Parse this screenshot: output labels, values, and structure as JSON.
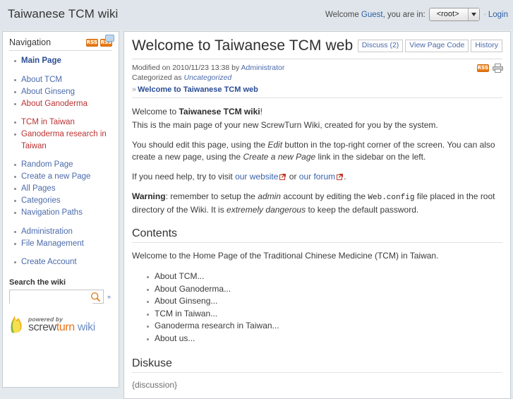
{
  "header": {
    "wiki_title": "Taiwanese TCM wiki",
    "welcome_prefix": "Welcome",
    "user_name": "Guest",
    "welcome_suffix": ", you are in:",
    "namespace_value": "<root>",
    "separator": "·",
    "login_label": "Login"
  },
  "sidebar": {
    "heading": "Navigation",
    "rss_label": "RSS",
    "rss_discussion_label": "RSS",
    "items": [
      {
        "label": "Main Page",
        "style": "bold"
      },
      {
        "label": "",
        "style": "spacer"
      },
      {
        "label": "About TCM",
        "style": "blue"
      },
      {
        "label": "About Ginseng",
        "style": "blue"
      },
      {
        "label": "About Ganoderma",
        "style": "red"
      },
      {
        "label": "",
        "style": "spacer"
      },
      {
        "label": "TCM in Taiwan",
        "style": "red"
      },
      {
        "label": "Ganoderma research in Taiwan",
        "style": "red"
      },
      {
        "label": "",
        "style": "spacer"
      },
      {
        "label": "Random Page",
        "style": "blue"
      },
      {
        "label": "Create a new Page",
        "style": "blue"
      },
      {
        "label": "All Pages",
        "style": "blue"
      },
      {
        "label": "Categories",
        "style": "blue"
      },
      {
        "label": "Navigation Paths",
        "style": "blue"
      },
      {
        "label": "",
        "style": "spacer"
      },
      {
        "label": "Administration",
        "style": "blue"
      },
      {
        "label": "File Management",
        "style": "blue"
      },
      {
        "label": "",
        "style": "spacer"
      },
      {
        "label": "Create Account",
        "style": "blue"
      }
    ],
    "search": {
      "label": "Search the wiki",
      "value": "",
      "placeholder": "",
      "more_label": "»"
    },
    "branding": {
      "powered_by": "powered by",
      "name_part1": "screw",
      "name_part2": "turn",
      "name_part3": "wiki"
    }
  },
  "content": {
    "title": "Welcome to Taiwanese TCM web",
    "actions": [
      {
        "label": "Discuss (2)"
      },
      {
        "label": "View Page Code"
      },
      {
        "label": "History"
      }
    ],
    "meta": {
      "modified_prefix": "Modified on",
      "modified_date": "2010/11/23 13:38",
      "modified_by_prefix": "by",
      "modified_by": "Administrator",
      "categorized_prefix": "Categorized as",
      "category": "Uncategorized",
      "rss_label": "RSS"
    },
    "breadcrumb": {
      "arrow": "»",
      "label": "Welcome to Taiwanese TCM web"
    },
    "paragraphs": {
      "p1_a": "Welcome to ",
      "p1_b": "Taiwanese TCM wiki",
      "p1_c": "!",
      "p2": "This is the main page of your new ScrewTurn Wiki, created for you by the system.",
      "p3_a": "You should edit this page, using the ",
      "p3_b": "Edit",
      "p3_c": " button in the top-right corner of the screen. You can also create a new page, using the ",
      "p3_d": "Create a new Page",
      "p3_e": " link in the sidebar on the left.",
      "p4_a": "If you need help, try to visit ",
      "p4_link1": "our website",
      "p4_b": " or ",
      "p4_link2": "our forum",
      "p4_c": ".",
      "p5_warning": "Warning",
      "p5_a": ": remember to setup the ",
      "p5_b": "admin",
      "p5_c": " account by editing the ",
      "p5_code": "Web.config",
      "p5_d": " file placed in the root directory of the Wiki. It is ",
      "p5_e": "extremely dangerous",
      "p5_f": " to keep the default password."
    },
    "contents_heading": "Contents",
    "contents_intro": "Welcome to the Home Page of the Traditional Chinese Medicine (TCM) in Taiwan.",
    "contents_items": [
      "About TCM...",
      "About Ganoderma...",
      "About Ginseng...",
      "TCM in Taiwan...",
      "Ganoderma research in Taiwan...",
      "About us..."
    ],
    "discussion_heading": "Diskuse",
    "discussion_placeholder": "{discussion}"
  },
  "colors": {
    "header_bg": "#dfe5ea",
    "page_bg": "#e4e9ed",
    "link_blue": "#4b6bab",
    "link_red": "#bb3333",
    "rss_orange": "#e8730d"
  }
}
